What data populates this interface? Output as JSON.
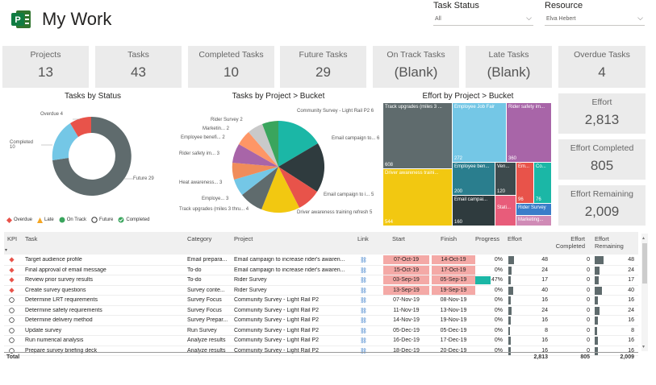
{
  "app": {
    "title": "My Work"
  },
  "filters": {
    "task_status_label": "Task Status",
    "task_status_value": "All",
    "resource_label": "Resource",
    "resource_value": "Elva Hebert"
  },
  "cards": [
    {
      "label": "Projects",
      "value": "13"
    },
    {
      "label": "Tasks",
      "value": "43"
    },
    {
      "label": "Completed Tasks",
      "value": "10"
    },
    {
      "label": "Future Tasks",
      "value": "29"
    },
    {
      "label": "On Track Tasks",
      "value": "(Blank)"
    },
    {
      "label": "Late Tasks",
      "value": "(Blank)"
    },
    {
      "label": "Overdue Tasks",
      "value": "4"
    }
  ],
  "effort_cards": [
    {
      "label": "Effort",
      "value": "2,813"
    },
    {
      "label": "Effort Completed",
      "value": "805"
    },
    {
      "label": "Effort Remaining",
      "value": "2,009"
    }
  ],
  "status_chart": {
    "title": "Tasks by Status",
    "labels": {
      "overdue": "Overdue 4",
      "completed": "Completed 10",
      "future": "Future 29"
    },
    "legend": [
      "Overdue",
      "Late",
      "On Track",
      "Future",
      "Completed"
    ],
    "colors": {
      "overdue": "#e8534a",
      "late": "#f5a623",
      "ontrack": "#3aa55d",
      "future": "#5f6b6d",
      "completed": "#74c7e6"
    }
  },
  "pie_chart": {
    "title": "Tasks by Project > Bucket",
    "labels": [
      "Community Survey - Light Rail P2 6",
      "Email campaign to... 6",
      "Email campaign to i... 5",
      "Driver awareness training refresh 5",
      "Track upgrades (miles 3 thru... 4",
      "Employe... 3",
      "Heat awareness... 3",
      "Rider safety im... 3",
      "Employee benefi... 2",
      "Marketin... 2",
      "Rider Survey 2"
    ]
  },
  "treemap": {
    "title": "Effort by Project > Bucket",
    "tiles": [
      {
        "label": "Track upgrades (miles 3 ...",
        "value": "608"
      },
      {
        "label": "Employee Job Fair",
        "value": "272"
      },
      {
        "label": "Rider safety im...",
        "value": "360"
      },
      {
        "label": "Driver awareness traini...",
        "value": "544"
      },
      {
        "label": "Employee ben...",
        "value": "200"
      },
      {
        "label": "Ven...",
        "value": "120"
      },
      {
        "label": "Em...",
        "value": "96"
      },
      {
        "label": "Co...",
        "value": "76"
      },
      {
        "label": "Email campai...",
        "value": "160"
      },
      {
        "label": "Stati...",
        "value": ""
      },
      {
        "label": "Rider Survey",
        "value": ""
      },
      {
        "label": "Marketing...",
        "value": ""
      }
    ]
  },
  "table": {
    "headers": {
      "kpi": "KPI",
      "task": "Task",
      "category": "Category",
      "project": "Project",
      "link": "Link",
      "start": "Start",
      "finish": "Finish",
      "progress": "Progress",
      "effort": "Effort",
      "effort_completed": "Effort Completed",
      "effort_remaining": "Effort Remaining"
    },
    "rows": [
      {
        "kpi": "overdue",
        "task": "Target audience profile",
        "category": "Email prepara...",
        "project": "Email campaign to increase rider's awaren...",
        "start": "07-Oct-19",
        "finish": "14-Oct-19",
        "progress": "0%",
        "effort": "48",
        "ec": "0",
        "er": "48"
      },
      {
        "kpi": "overdue",
        "task": "Final approval of email message",
        "category": "To-do",
        "project": "Email campaign to increase rider's awaren...",
        "start": "15-Oct-19",
        "finish": "17-Oct-19",
        "progress": "0%",
        "effort": "24",
        "ec": "0",
        "er": "24"
      },
      {
        "kpi": "overdue",
        "task": "Review prior survey results",
        "category": "To-do",
        "project": "Rider Survey",
        "start": "03-Sep-19",
        "finish": "05-Sep-19",
        "progress": "47%",
        "effort": "17",
        "ec": "0",
        "er": "17"
      },
      {
        "kpi": "overdue",
        "task": "Create survey questions",
        "category": "Survey conte...",
        "project": "Rider Survey",
        "start": "13-Sep-19",
        "finish": "19-Sep-19",
        "progress": "0%",
        "effort": "40",
        "ec": "0",
        "er": "40"
      },
      {
        "kpi": "future",
        "task": "Determine LRT requirements",
        "category": "Survey Focus",
        "project": "Community Survey - Light Rail P2",
        "start": "07-Nov-19",
        "finish": "08-Nov-19",
        "progress": "0%",
        "effort": "16",
        "ec": "0",
        "er": "16"
      },
      {
        "kpi": "future",
        "task": "Determine safety requirements",
        "category": "Survey Focus",
        "project": "Community Survey - Light Rail P2",
        "start": "11-Nov-19",
        "finish": "13-Nov-19",
        "progress": "0%",
        "effort": "24",
        "ec": "0",
        "er": "24"
      },
      {
        "kpi": "future",
        "task": "Determine delivery method",
        "category": "Survey Prepar...",
        "project": "Community Survey - Light Rail P2",
        "start": "14-Nov-19",
        "finish": "19-Nov-19",
        "progress": "0%",
        "effort": "16",
        "ec": "0",
        "er": "16"
      },
      {
        "kpi": "future",
        "task": "Update survey",
        "category": "Run Survey",
        "project": "Community Survey - Light Rail P2",
        "start": "05-Dec-19",
        "finish": "05-Dec-19",
        "progress": "0%",
        "effort": "8",
        "ec": "0",
        "er": "8"
      },
      {
        "kpi": "future",
        "task": "Run numerical analysis",
        "category": "Analyze results",
        "project": "Community Survey - Light Rail P2",
        "start": "16-Dec-19",
        "finish": "17-Dec-19",
        "progress": "0%",
        "effort": "16",
        "ec": "0",
        "er": "16"
      },
      {
        "kpi": "future",
        "task": "Prepare survey briefing deck",
        "category": "Analyze results",
        "project": "Community Survey - Light Rail P2",
        "start": "18-Dec-19",
        "finish": "20-Dec-19",
        "progress": "0%",
        "effort": "16",
        "ec": "0",
        "er": "16"
      }
    ],
    "total": {
      "label": "Total",
      "effort": "2,813",
      "ec": "805",
      "er": "2,009"
    }
  }
}
